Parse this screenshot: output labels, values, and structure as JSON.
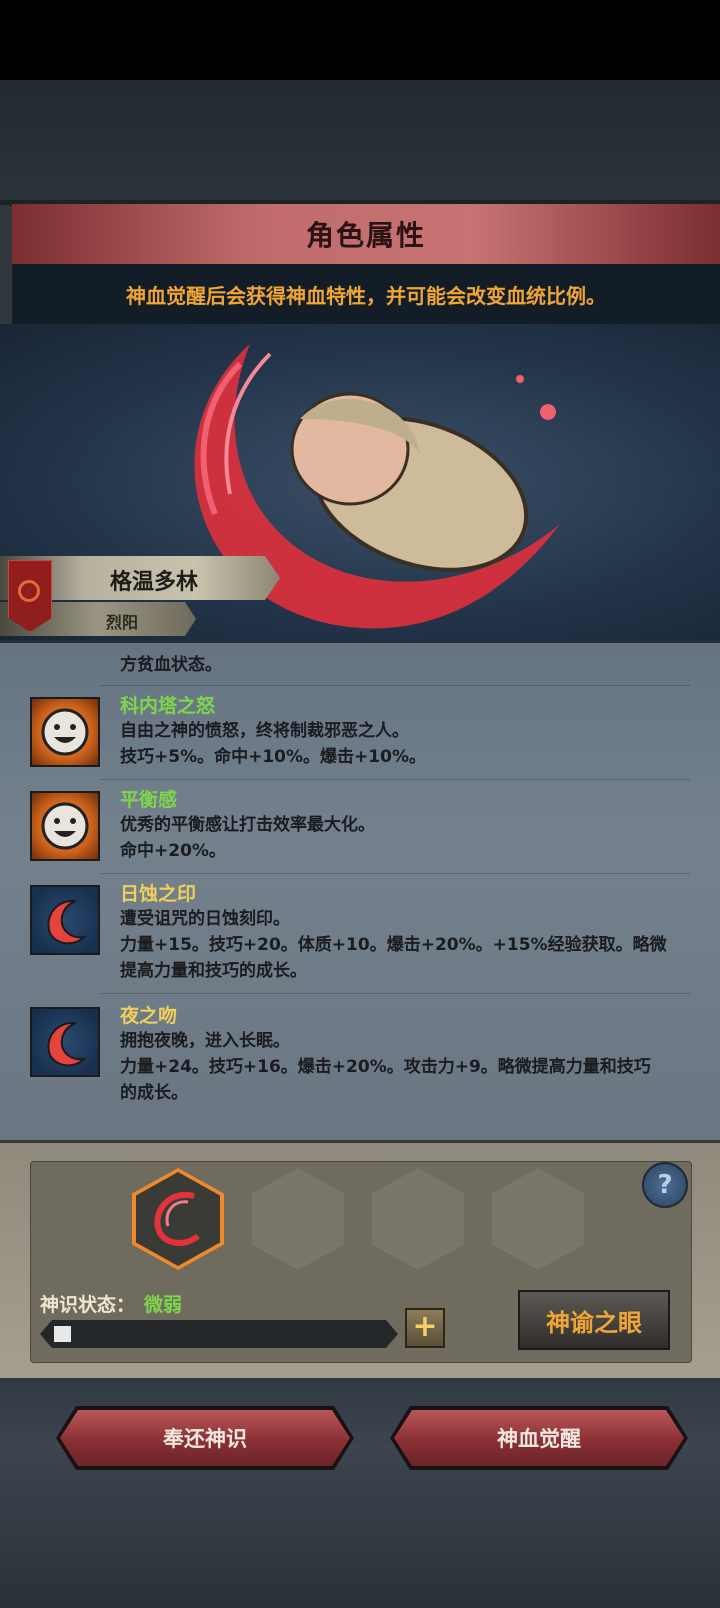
{
  "header": {
    "title": "角色属性",
    "notice": "神血觉醒后会获得神血特性，并可能会改变血统比例。"
  },
  "character": {
    "name": "格温多林",
    "subtitle": "烈阳"
  },
  "traits": {
    "partial_top": "方贫血状态。",
    "items": [
      {
        "name": "科内塔之怒",
        "name_color": "#7ed74a",
        "icon": "smiley-face-icon",
        "lines": [
          "自由之神的愤怒，终将制裁邪恶之人。",
          "技巧+5%。命中+10%。爆击+10%。"
        ]
      },
      {
        "name": "平衡感",
        "name_color": "#7ed74a",
        "icon": "smiley-face-icon",
        "lines": [
          "优秀的平衡感让打击效率最大化。",
          "命中+20%。"
        ]
      },
      {
        "name": "日蚀之印",
        "name_color": "#f0d05a",
        "icon": "crimson-moon-icon",
        "lines": [
          "遭受诅咒的日蚀刻印。",
          "力量+15。技巧+20。体质+10。爆击+20%。+15%经验获取。略微",
          "提高力量和技巧的成长。"
        ]
      },
      {
        "name": "夜之吻",
        "name_color": "#f0d05a",
        "icon": "crimson-moon-icon",
        "lines": [
          "拥抱夜晚，进入长眠。",
          "力量+24。技巧+16。爆击+20%。攻击力+9。略微提高力量和技巧",
          "的成长。"
        ]
      }
    ]
  },
  "awakening": {
    "status_label": "神识状态：",
    "status_value": "微弱",
    "progress": 0.05,
    "plus_label": "+",
    "eye_button": "神谕之眼",
    "help_label": "?"
  },
  "actions": {
    "return_label": "奉还神识",
    "awaken_label": "神血觉醒"
  }
}
